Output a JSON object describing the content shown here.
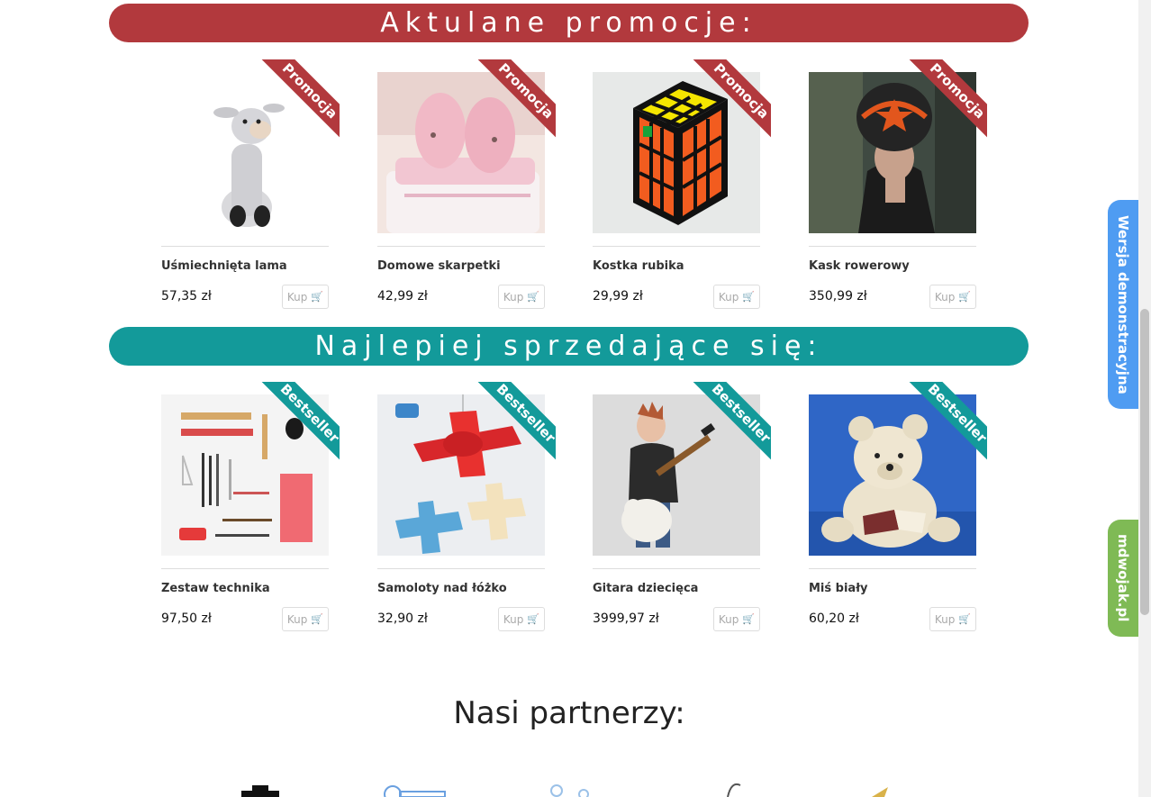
{
  "sections": {
    "promo_title": "Aktulane promocje:",
    "best_title": "Najlepiej sprzedające się:",
    "partners_title": "Nasi partnerzy:"
  },
  "ribbons": {
    "promo": "Promocja",
    "best": "Bestseller"
  },
  "buy_label": "Kup",
  "buy_icon": "shopping-cart-icon",
  "promo_products": [
    {
      "name": "Uśmiechnięta lama",
      "price": "57,35 zł",
      "image": "plush-llama"
    },
    {
      "name": "Domowe skarpetki",
      "price": "42,99 zł",
      "image": "pink-baby-booties"
    },
    {
      "name": "Kostka rubika",
      "price": "29,99 zł",
      "image": "rubiks-cube"
    },
    {
      "name": "Kask rowerowy",
      "price": "350,99 zł",
      "image": "woman-in-helmet"
    }
  ],
  "best_products": [
    {
      "name": "Zestaw technika",
      "price": "97,50 zł",
      "image": "drafting-tools"
    },
    {
      "name": "Samoloty nad łóżko",
      "price": "32,90 zł",
      "image": "toy-airplanes"
    },
    {
      "name": "Gitara dziecięca",
      "price": "3999,97 zł",
      "image": "kid-with-guitar"
    },
    {
      "name": "Miś biały",
      "price": "60,20 zł",
      "image": "white-teddy-bear"
    }
  ],
  "side_tabs": {
    "demo": "Wersja demonstracyjna",
    "site": "mdwojak.pl"
  },
  "colors": {
    "promo": "#b2393d",
    "best": "#139a9a",
    "demo_tab": "#4f9cf2",
    "site_tab": "#7fba55"
  }
}
